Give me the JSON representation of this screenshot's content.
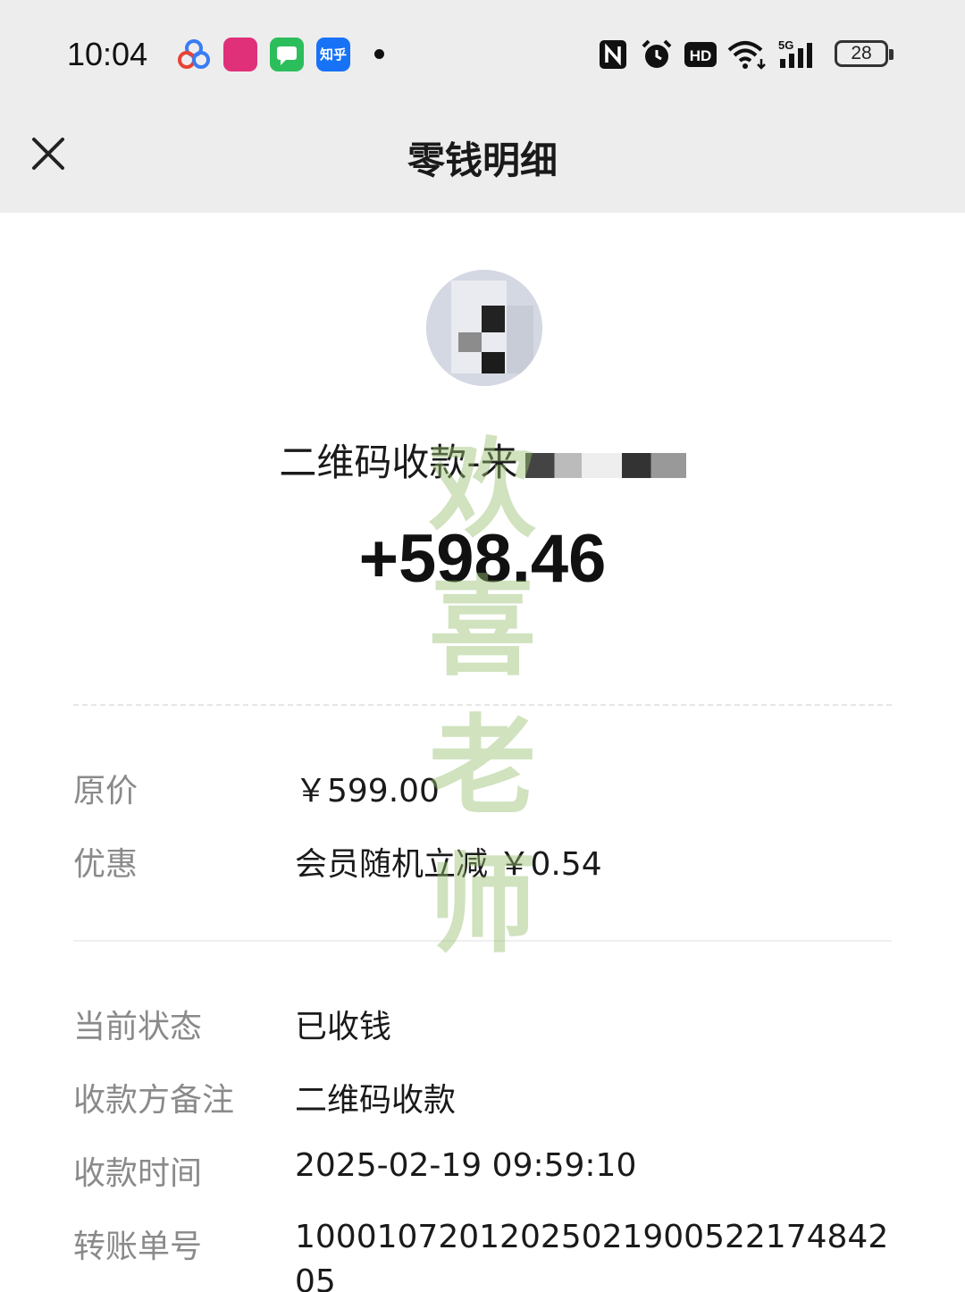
{
  "status_bar": {
    "time": "10:04",
    "apps": [
      "baidu-icon",
      "vipshop-icon",
      "messages-icon",
      "zhihu-icon"
    ],
    "zhihu_label": "知乎",
    "battery": "28"
  },
  "header": {
    "title": "零钱明细",
    "close_icon": "close-icon"
  },
  "summary": {
    "payee": "二维码收款-来",
    "amount": "+598.46"
  },
  "details_price": [
    {
      "label": "原价",
      "value": "￥599.00"
    },
    {
      "label": "优惠",
      "value": "会员随机立减 ￥0.54"
    }
  ],
  "details_status": [
    {
      "label": "当前状态",
      "value": "已收钱"
    },
    {
      "label": "收款方备注",
      "value": "二维码收款"
    },
    {
      "label": "收款时间",
      "value": "2025-02-19 09:59:10"
    },
    {
      "label": "转账单号",
      "value": "1000107201202502190052217484205"
    }
  ],
  "watermark": [
    "欢",
    "喜",
    "老",
    "师"
  ],
  "colors": {
    "header_bg": "#ededed",
    "label_gray": "#8a8a8a",
    "watermark_green": "#96be6e"
  }
}
